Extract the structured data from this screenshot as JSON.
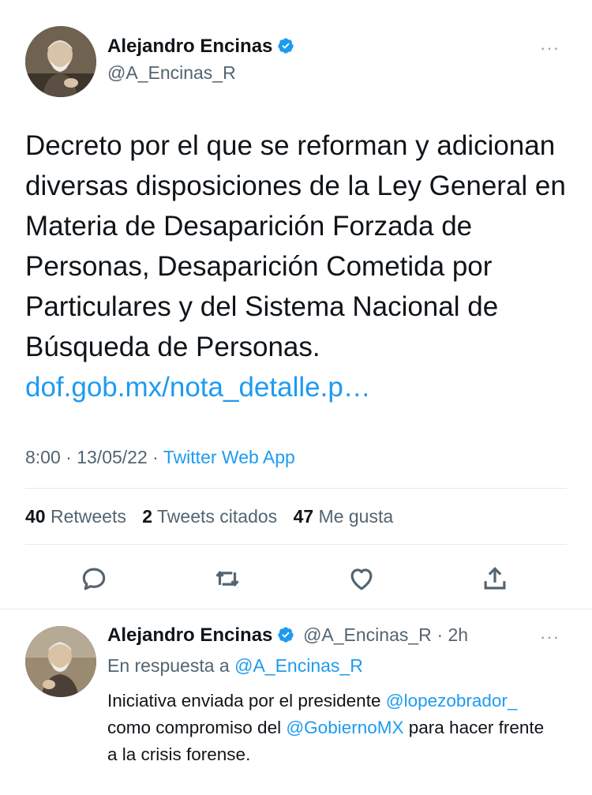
{
  "main_tweet": {
    "author_name": "Alejandro Encinas",
    "author_handle": "@A_Encinas_R",
    "more_label": "···",
    "text": "Decreto por el que se reforman y adicionan diversas disposiciones de la Ley General en Materia de Desaparición Forzada de Personas, Desaparición Cometida por Particulares y del Sistema Nacional de Búsqueda de Personas.",
    "link": "dof.gob.mx/nota_detalle.p…",
    "time": "8:00",
    "date": "13/05/22",
    "separator": "·",
    "source": "Twitter Web App",
    "stats": {
      "retweets_count": "40",
      "retweets_label": "Retweets",
      "quotes_count": "2",
      "quotes_label": "Tweets citados",
      "likes_count": "47",
      "likes_label": "Me gusta"
    },
    "actions": [
      "reply-icon",
      "retweet-icon",
      "like-icon",
      "share-icon"
    ]
  },
  "reply_tweet": {
    "author_name": "Alejandro Encinas",
    "author_handle": "@A_Encinas_R",
    "age": "· 2h",
    "more_label": "···",
    "in_reply_prefix": "En respuesta a",
    "in_reply_handle": "@A_Encinas_R",
    "text_part1": "Iniciativa enviada por el presidente",
    "mention1": "@lopezobrador_",
    "text_part2": "como compromiso del",
    "mention2": "@GobiernoMX",
    "text_part3": "para hacer frente a la crisis forense."
  },
  "colors": {
    "accent": "#1d9bf0",
    "text": "#0f1419",
    "secondary": "#536471",
    "divider": "#e6ecf0"
  }
}
